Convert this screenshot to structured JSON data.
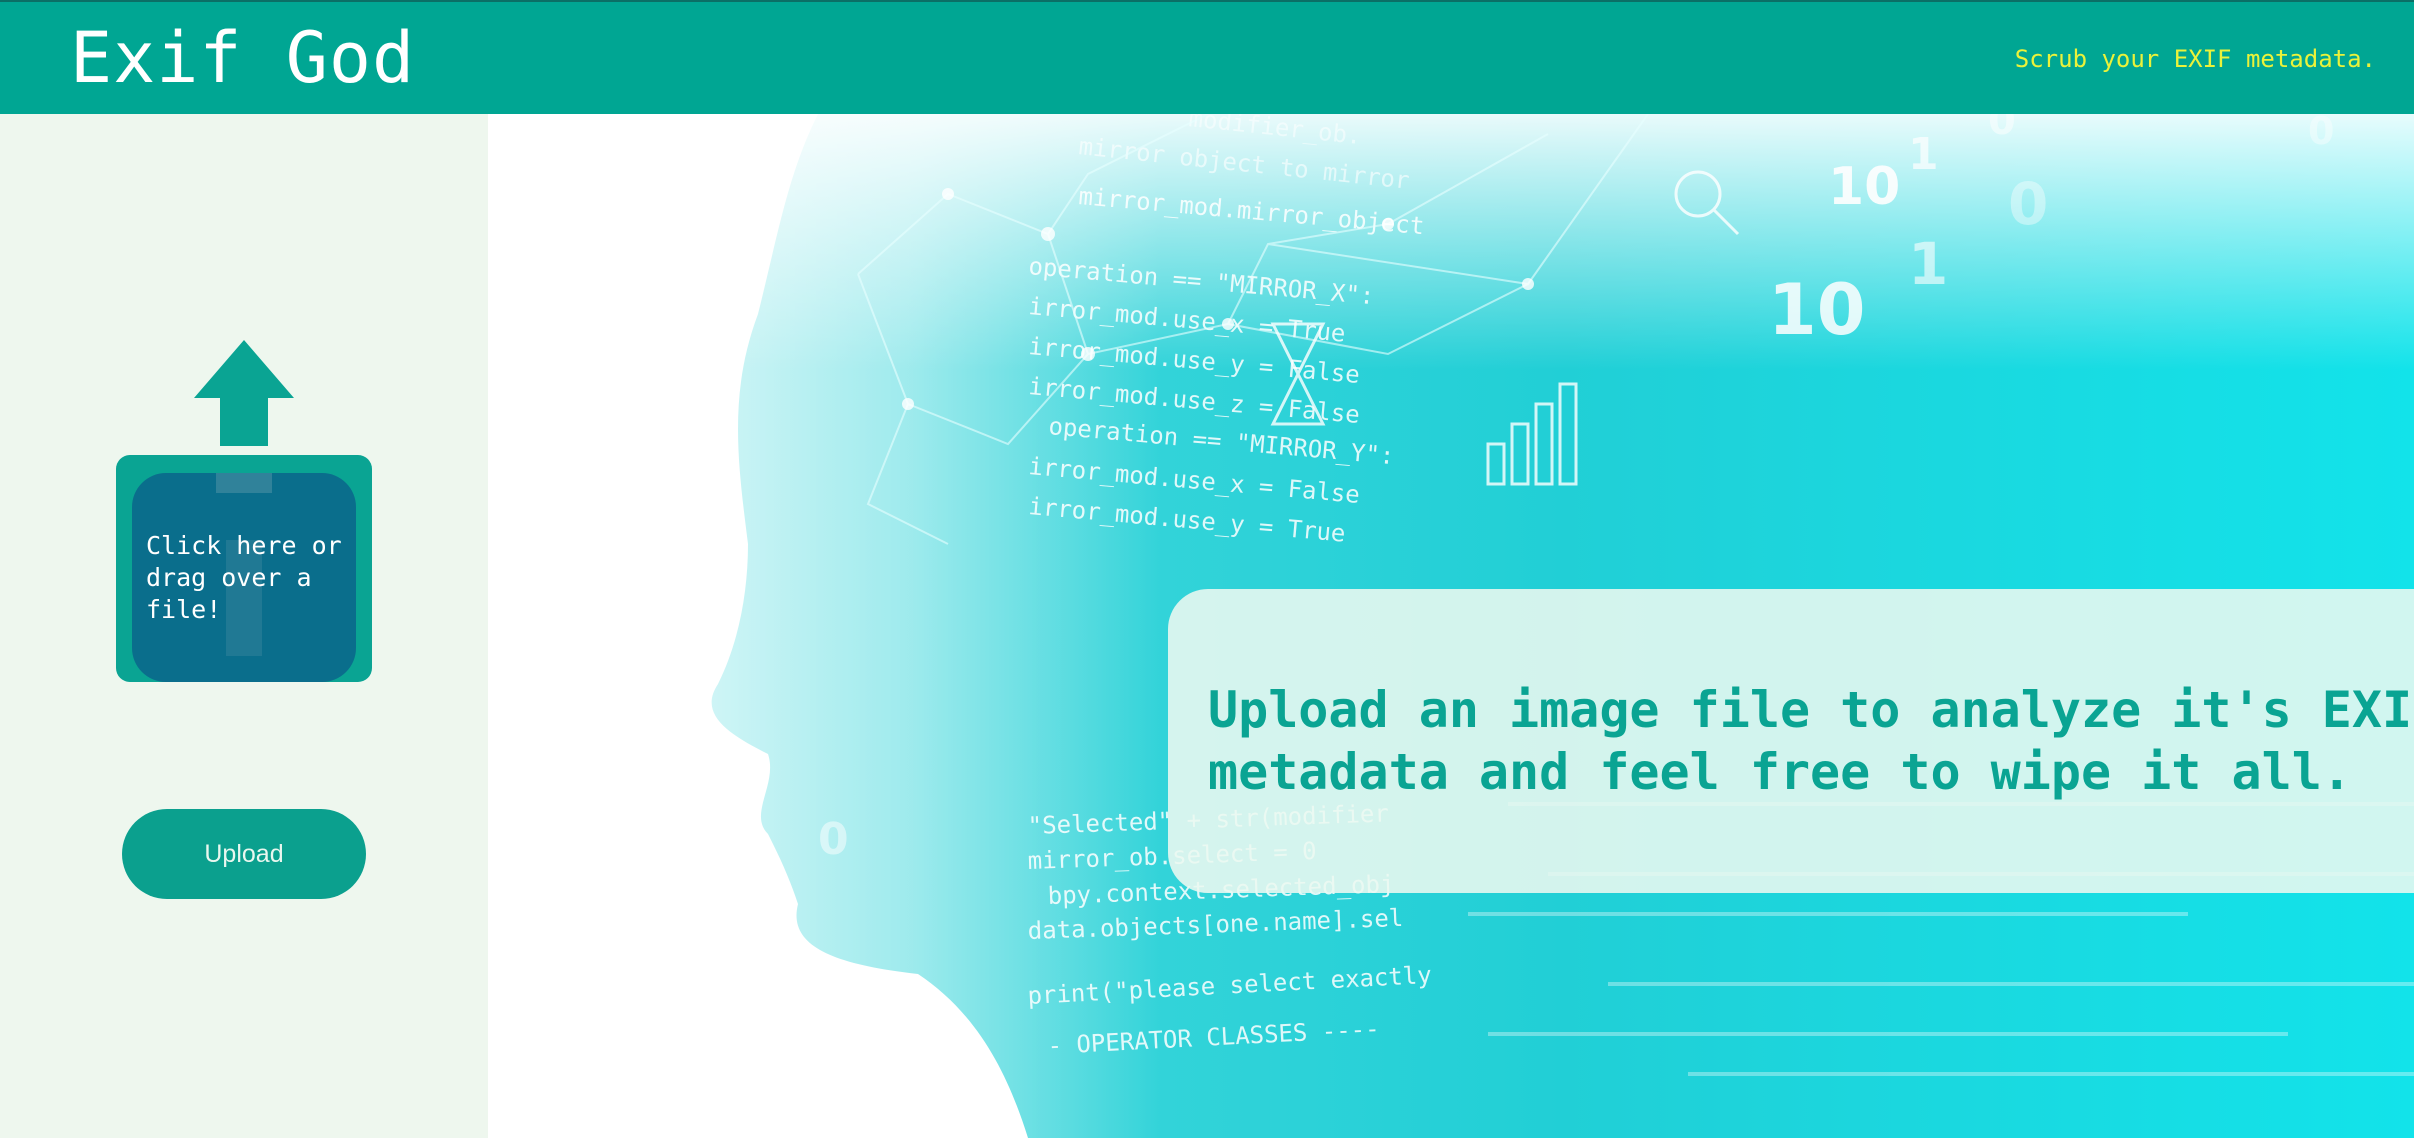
{
  "header": {
    "title": "Exif God",
    "tagline": "Scrub your EXIF metadata."
  },
  "sidebar": {
    "dropzone_label": "Click here or drag over a file!",
    "upload_label": "Upload"
  },
  "main": {
    "intro": "Upload an image file to analyze it's EXIF metadata and feel free to wipe it all."
  },
  "colors": {
    "header_bg": "#00a693",
    "tagline": "#eaf23a",
    "sidebar_bg": "#eef7ee",
    "accent": "#0aa493",
    "dropzone_inner": "#0a6e8c",
    "hero_cyan": "#1fd6db"
  },
  "icons": {
    "dropzone": "upload-arrow-icon"
  }
}
